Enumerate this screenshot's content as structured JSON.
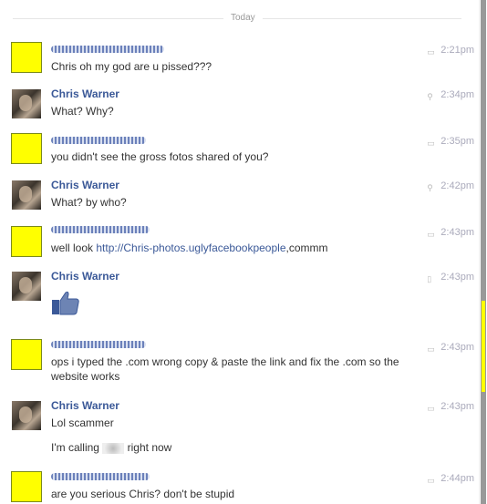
{
  "divider": {
    "label": "Today"
  },
  "messages": [
    {
      "name": "",
      "text": "Chris oh my god are u pissed???",
      "time": "2:21pm"
    },
    {
      "name": "Chris Warner",
      "text": "What? Why?",
      "time": "2:34pm"
    },
    {
      "name": "",
      "text": "you didn't see the gross fotos shared of you?",
      "time": "2:35pm"
    },
    {
      "name": "Chris Warner",
      "text": "What? by who?",
      "time": "2:42pm"
    },
    {
      "name": "",
      "text_prefix": "well look ",
      "link": "http://Chris-photos.uglyfacebookpeople",
      "text_suffix": ",commm",
      "time": "2:43pm"
    },
    {
      "name": "Chris Warner",
      "text": "",
      "time": "2:43pm"
    },
    {
      "name": "",
      "text": "ops i typed the .com wrong copy & paste the link and fix the .com so the website works",
      "time": "2:43pm"
    },
    {
      "name": "Chris Warner",
      "text": "Lol scammer",
      "text2_prefix": "I'm calling ",
      "text2_suffix": " right now",
      "time": "2:43pm"
    },
    {
      "name": "",
      "text": "are you serious Chris? don't be stupid",
      "time": "2:44pm"
    }
  ],
  "icons": {
    "chat": "speech-bubble-icon",
    "location": "map-pin-icon",
    "mobile": "mobile-phone-icon",
    "like": "thumbs-up-icon"
  },
  "colors": {
    "accent": "#3b5998",
    "avatar_yellow": "#ffff00",
    "timestamp": "#aab"
  }
}
